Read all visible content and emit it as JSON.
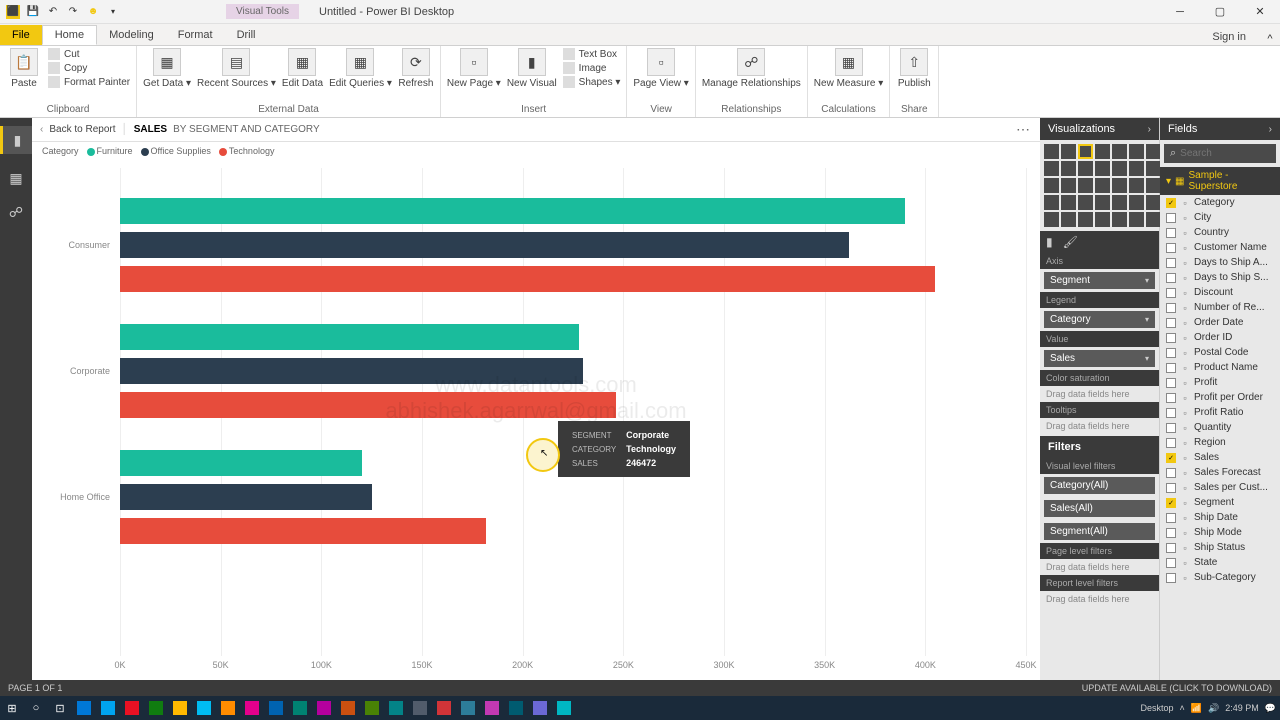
{
  "app": {
    "title": "Untitled - Power BI Desktop",
    "visual_tools": "Visual Tools",
    "sign_in": "Sign in"
  },
  "tabs": {
    "file": "File",
    "home": "Home",
    "modeling": "Modeling",
    "format": "Format",
    "drill": "Drill"
  },
  "ribbon": {
    "clipboard": {
      "label": "Clipboard",
      "paste": "Paste",
      "cut": "Cut",
      "copy": "Copy",
      "format_painter": "Format Painter"
    },
    "external": {
      "label": "External Data",
      "get_data": "Get Data ▾",
      "recent": "Recent Sources ▾",
      "edit": "Edit Data",
      "edit_queries": "Edit Queries ▾",
      "refresh": "Refresh"
    },
    "insert": {
      "label": "Insert",
      "new_page": "New Page ▾",
      "new_visual": "New Visual",
      "textbox": "Text Box",
      "image": "Image",
      "shapes": "Shapes ▾"
    },
    "view": {
      "label": "View",
      "page_view": "Page View ▾"
    },
    "relationships": {
      "label": "Relationships",
      "manage": "Manage Relationships"
    },
    "calculations": {
      "label": "Calculations",
      "measure": "New Measure ▾"
    },
    "share": {
      "label": "Share",
      "publish": "Publish"
    }
  },
  "canvas": {
    "back": "Back to Report",
    "title": "SALES",
    "subtitle": "BY SEGMENT AND CATEGORY",
    "legend_label": "Category",
    "legend": [
      {
        "name": "Furniture",
        "color": "#1abc9c"
      },
      {
        "name": "Office Supplies",
        "color": "#2c3e50"
      },
      {
        "name": "Technology",
        "color": "#e74c3c"
      }
    ]
  },
  "chart_data": {
    "type": "bar",
    "orientation": "horizontal",
    "categories": [
      "Consumer",
      "Corporate",
      "Home Office"
    ],
    "series": [
      {
        "name": "Furniture",
        "color": "#1abc9c",
        "values": [
          390000,
          228000,
          120000
        ]
      },
      {
        "name": "Office Supplies",
        "color": "#2c3e50",
        "values": [
          362000,
          230000,
          125000
        ]
      },
      {
        "name": "Technology",
        "color": "#e74c3c",
        "values": [
          405000,
          246472,
          182000
        ]
      }
    ],
    "xlim": [
      0,
      450000
    ],
    "xticks": [
      "0K",
      "50K",
      "100K",
      "150K",
      "200K",
      "250K",
      "300K",
      "350K",
      "400K",
      "450K"
    ]
  },
  "tooltip": {
    "segment_label": "SEGMENT",
    "segment": "Corporate",
    "category_label": "CATEGORY",
    "category": "Technology",
    "sales_label": "SALES",
    "sales": "246472"
  },
  "viz": {
    "title": "Visualizations",
    "axis": "Axis",
    "axis_field": "Segment",
    "legend": "Legend",
    "legend_field": "Category",
    "value": "Value",
    "value_field": "Sales",
    "color_sat": "Color saturation",
    "drag": "Drag data fields here",
    "tooltips": "Tooltips",
    "filters": "Filters",
    "visual_filters": "Visual level filters",
    "f1": "Category(All)",
    "f2": "Sales(All)",
    "f3": "Segment(All)",
    "page_filters": "Page level filters",
    "report_filters": "Report level filters"
  },
  "fields": {
    "title": "Fields",
    "search_placeholder": "Search",
    "table": "Sample - Superstore",
    "items": [
      {
        "name": "Category",
        "checked": true
      },
      {
        "name": "City",
        "checked": false
      },
      {
        "name": "Country",
        "checked": false
      },
      {
        "name": "Customer Name",
        "checked": false
      },
      {
        "name": "Days to Ship A...",
        "checked": false
      },
      {
        "name": "Days to Ship S...",
        "checked": false
      },
      {
        "name": "Discount",
        "checked": false
      },
      {
        "name": "Number of Re...",
        "checked": false
      },
      {
        "name": "Order Date",
        "checked": false
      },
      {
        "name": "Order ID",
        "checked": false
      },
      {
        "name": "Postal Code",
        "checked": false
      },
      {
        "name": "Product Name",
        "checked": false
      },
      {
        "name": "Profit",
        "checked": false
      },
      {
        "name": "Profit per Order",
        "checked": false
      },
      {
        "name": "Profit Ratio",
        "checked": false
      },
      {
        "name": "Quantity",
        "checked": false
      },
      {
        "name": "Region",
        "checked": false
      },
      {
        "name": "Sales",
        "checked": true
      },
      {
        "name": "Sales Forecast",
        "checked": false
      },
      {
        "name": "Sales per Cust...",
        "checked": false
      },
      {
        "name": "Segment",
        "checked": true
      },
      {
        "name": "Ship Date",
        "checked": false
      },
      {
        "name": "Ship Mode",
        "checked": false
      },
      {
        "name": "Ship Status",
        "checked": false
      },
      {
        "name": "State",
        "checked": false
      },
      {
        "name": "Sub-Category",
        "checked": false
      }
    ]
  },
  "status": {
    "page": "PAGE 1 OF 1",
    "update": "UPDATE AVAILABLE (CLICK TO DOWNLOAD)"
  },
  "tray": {
    "desktop": "Desktop",
    "time": "2:49 PM",
    "date": "########"
  },
  "watermark": {
    "l1": "www.datantools.com",
    "l2": "abhishek.agarrwal@gmail.com"
  }
}
